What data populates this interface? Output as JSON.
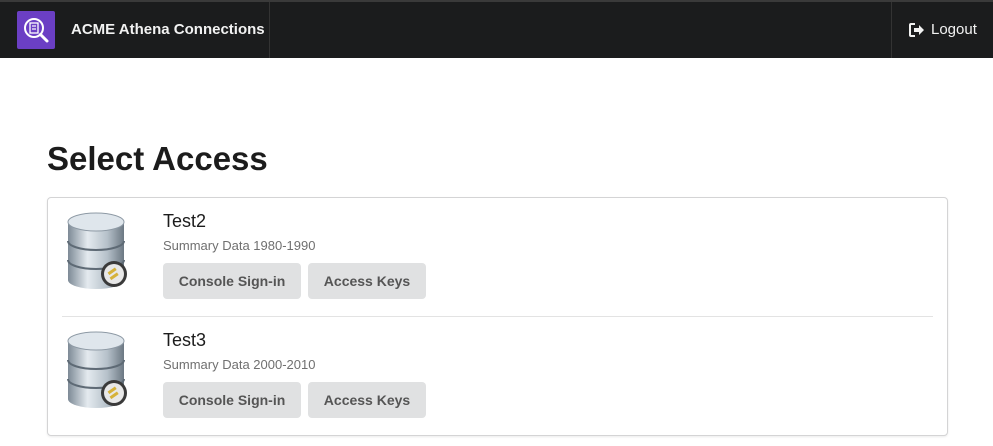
{
  "header": {
    "title": "ACME Athena Connections",
    "logo_icon": "athena-search-icon",
    "logout_label": "Logout",
    "logout_icon": "sign-out-icon",
    "background_color": "#1b1c1d",
    "logo_color": "#6b3fc4"
  },
  "page": {
    "title": "Select Access"
  },
  "items": [
    {
      "title": "Test2",
      "description": "Summary Data 1980-1990",
      "icon": "database-plug-icon",
      "console_label": "Console Sign-in",
      "keys_label": "Access Keys"
    },
    {
      "title": "Test3",
      "description": "Summary Data 2000-2010",
      "icon": "database-plug-icon",
      "console_label": "Console Sign-in",
      "keys_label": "Access Keys"
    }
  ]
}
